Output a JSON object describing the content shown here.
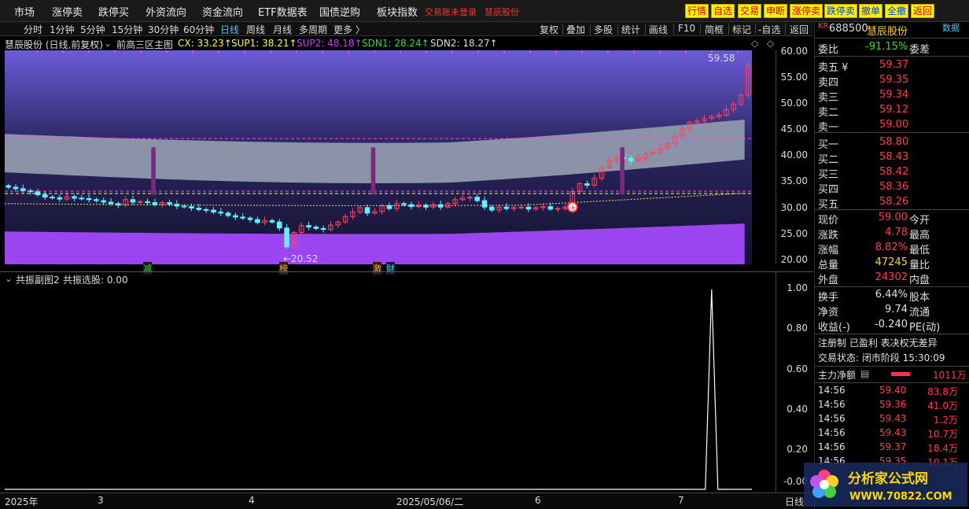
{
  "menu": [
    "市场",
    "涨停卖",
    "跌停买",
    "外资流向",
    "资金流向",
    "ETF数据表",
    "国债逆购",
    "板块指数"
  ],
  "status_text": "交易账未登录",
  "stock_name_top": "慧辰股份",
  "toolbar_buttons": [
    "行情",
    "自选",
    "交易",
    "申断",
    "涨停卖",
    "跌停卖",
    "撤单",
    "全撤",
    "返回"
  ],
  "periods": [
    "分时",
    "1分钟",
    "5分钟",
    "15分钟",
    "30分钟",
    "60分钟",
    "日线",
    "周线",
    "月线",
    "多周期",
    "更多 〉"
  ],
  "active_period": "日线",
  "tools": [
    "复权",
    "叠加",
    "多股",
    "统计",
    "画线",
    "F10",
    "简框",
    "标记",
    "-自选",
    "返回"
  ],
  "main_header": {
    "title": "慧辰股份 (日线,前复权)",
    "indicator": "前高三区主图",
    "cx": "CX: 33.23↑",
    "sup1": "SUP1: 38.21↑",
    "sup2": "SUP2: 48.18↑",
    "sdn1": "SDN1: 28.24↑",
    "sdn2": "SDN2: 18.27↑"
  },
  "price_axis": [
    "60.00",
    "55.00",
    "50.00",
    "45.00",
    "40.00",
    "35.00",
    "30.00",
    "25.00",
    "20.00"
  ],
  "annotations": {
    "high": "59.58",
    "low": "←20.52",
    "tag1": "减",
    "tag2": "榜",
    "tag3": "激",
    "tag4": "财"
  },
  "sub_header": {
    "title": "共振副图2",
    "value": "共振选股: 0.00"
  },
  "sub_axis": [
    "1.00",
    "0.80",
    "0.60",
    "0.40",
    "0.20",
    "-0.00"
  ],
  "x_axis": [
    "2025年",
    "3",
    "4",
    "2025/05/06/二",
    "6",
    "7"
  ],
  "x_axis_right": "日线",
  "chart_data": {
    "type": "candlestick",
    "title": "慧辰股份 (日线,前复权)",
    "ylim": [
      19,
      62
    ],
    "levels": {
      "CX": 33.23,
      "SUP1": 38.21,
      "SUP2": 48.18,
      "SDN1": 28.24,
      "SDN2": 18.27
    },
    "high_marker": 59.58,
    "low_marker": 20.52,
    "closes": [
      34.5,
      34.2,
      33.8,
      33.6,
      33.0,
      32.5,
      32.4,
      32.1,
      32.6,
      32.3,
      32.2,
      32.0,
      31.8,
      31.5,
      31.2,
      30.9,
      32.0,
      31.5,
      31.6,
      31.4,
      31.0,
      31.4,
      31.1,
      30.7,
      30.6,
      30.3,
      30.0,
      29.9,
      29.5,
      29.3,
      28.8,
      28.5,
      28.3,
      28.0,
      27.4,
      27.8,
      27.5,
      26.3,
      22.5,
      25.4,
      26.8,
      26.5,
      26.2,
      26.0,
      26.9,
      27.5,
      28.6,
      29.5,
      30.4,
      29.3,
      29.6,
      30.8,
      30.2,
      31.2,
      31.0,
      30.6,
      30.9,
      30.5,
      31.0,
      30.5,
      31.2,
      32.0,
      32.3,
      32.5,
      31.8,
      30.5,
      29.9,
      30.5,
      30.2,
      30.4,
      30.5,
      30.1,
      30.4,
      30.6,
      30.1,
      30.2,
      30.5,
      33.6,
      35.2,
      34.9,
      36.3,
      38.4,
      39.9,
      40.5,
      40.3,
      39.8,
      40.3,
      41.2,
      41.5,
      42.3,
      43.2,
      44.8,
      46.2,
      47.5,
      47.8,
      48.3,
      48.7,
      49.0,
      50.1,
      51.2,
      53.0,
      59.0
    ],
    "signal_series": {
      "name": "共振选股",
      "spike_index": 96,
      "spike_value": 1.0,
      "ylim": [
        0,
        1
      ]
    }
  },
  "right_panel": {
    "code": "688500",
    "name": "慧辰股份",
    "code_prefix": "KR",
    "tag": "数据",
    "weibi_label": "委比",
    "weibi": "-91.15%",
    "weicha_label": "委差",
    "asks": [
      {
        "label": "卖五 ¥",
        "price": "59.37"
      },
      {
        "label": "卖四",
        "price": "59.35"
      },
      {
        "label": "卖三",
        "price": "59.34"
      },
      {
        "label": "卖二",
        "price": "59.12"
      },
      {
        "label": "卖一",
        "price": "59.00"
      }
    ],
    "bids": [
      {
        "label": "买一",
        "price": "58.80"
      },
      {
        "label": "买二",
        "price": "58.43"
      },
      {
        "label": "买三",
        "price": "58.42"
      },
      {
        "label": "买四",
        "price": "58.36"
      },
      {
        "label": "买五",
        "price": "58.26"
      }
    ],
    "stats": [
      {
        "l1": "现价",
        "v1": "59.00",
        "l2": "今开",
        "c": "red"
      },
      {
        "l1": "涨跌",
        "v1": "4.78",
        "l2": "最高",
        "c": "red"
      },
      {
        "l1": "涨幅",
        "v1": "8.82%",
        "l2": "最低",
        "c": "red"
      },
      {
        "l1": "总量",
        "v1": "47245",
        "l2": "量比",
        "c": "yellow"
      },
      {
        "l1": "外盘",
        "v1": "24302",
        "l2": "内盘",
        "c": "red"
      }
    ],
    "stats2": [
      {
        "l1": "换手",
        "v1": "6.44%",
        "l2": "股本"
      },
      {
        "l1": "净资",
        "v1": "9.74",
        "l2": "流通"
      },
      {
        "l1": "收益(-)",
        "v1": "-0.240",
        "l2": "PE(动)"
      }
    ],
    "flags": "注册制 已盈利 表决权无差异",
    "trade_status": "交易状态: 闭市阶段 15:30:09",
    "main_flow_label": "主力净额",
    "main_flow_value": "1011万",
    "ticks": [
      {
        "t": "14:56",
        "p": "59.40",
        "v": "83.8万"
      },
      {
        "t": "14:56",
        "p": "59.36",
        "v": "41.0万"
      },
      {
        "t": "14:56",
        "p": "59.43",
        "v": "1.2万"
      },
      {
        "t": "14:56",
        "p": "59.43",
        "v": "10.7万"
      },
      {
        "t": "14:56",
        "p": "59.37",
        "v": "18.4万"
      },
      {
        "t": "14:56",
        "p": "59.35",
        "v": "10.1万"
      }
    ]
  },
  "logo": {
    "title": "分析家公式网",
    "url": "WWW.70822.COM"
  }
}
